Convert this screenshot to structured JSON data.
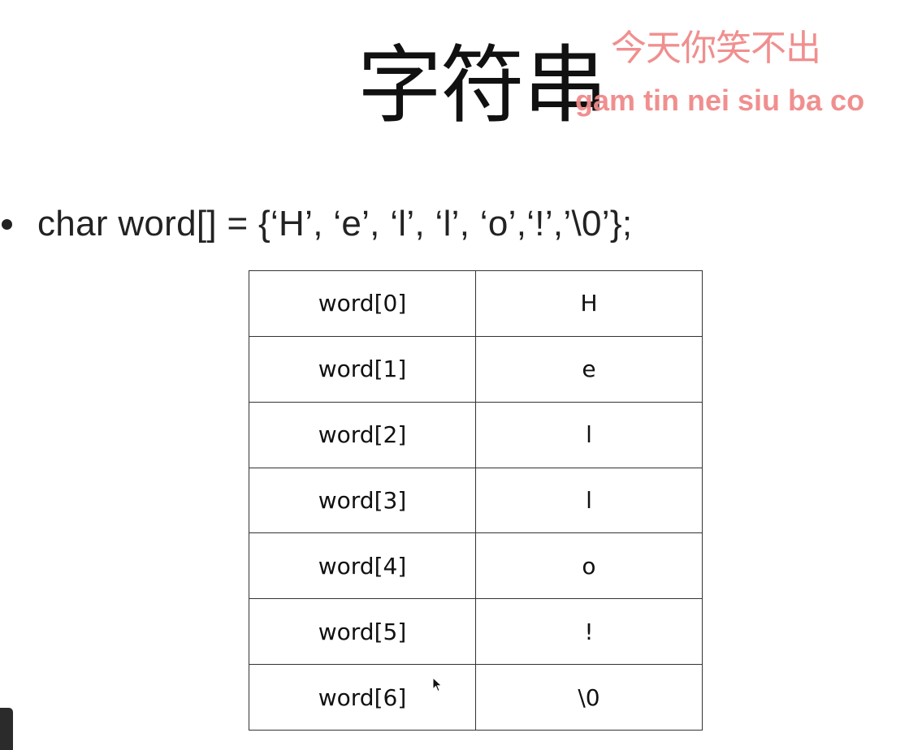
{
  "slide": {
    "title": "字符串",
    "subtitle_zh": "今天你笑不出",
    "subtitle_roman": "gam tin nei siu ba co",
    "bullet": "char word[] = {‘H’, ‘e’, ‘l’, ‘l’, ‘o’,‘!’,’\\0’};"
  },
  "table": {
    "rows": [
      {
        "index": "word[0]",
        "value": "H"
      },
      {
        "index": "word[1]",
        "value": "e"
      },
      {
        "index": "word[2]",
        "value": "l"
      },
      {
        "index": "word[3]",
        "value": "l"
      },
      {
        "index": "word[4]",
        "value": "o"
      },
      {
        "index": "word[5]",
        "value": "!"
      },
      {
        "index": "word[6]",
        "value": "\\0"
      }
    ]
  },
  "colors": {
    "subtitle": "#f08a8a",
    "text": "#111111",
    "table_border": "#333333"
  },
  "icons": {
    "cursor": "mouse-pointer-icon",
    "bullet": "bullet-dot-icon"
  }
}
